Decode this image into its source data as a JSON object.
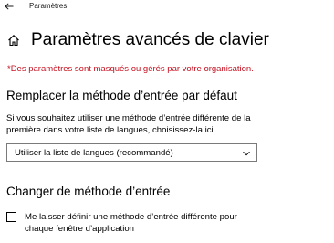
{
  "window": {
    "app_title": "Paramètres"
  },
  "header": {
    "title": "Paramètres avancés de clavier"
  },
  "org_warning": "*Des paramètres sont masqués ou gérés par votre organisation.",
  "input_method_section": {
    "title": "Remplacer la méthode d’entrée par défaut",
    "description_lines": [
      "Si vous souhaitez utiliser une méthode d’entrée différente de la",
      "première dans votre liste de langues, choisissez-la ici"
    ],
    "dropdown_value": "Utiliser la liste de langues (recommandé)"
  },
  "switch_section": {
    "title": "Changer de méthode d’entrée",
    "checkbox_checked": false,
    "checkbox_label_lines": [
      "Me laisser définir une méthode d’entrée différente pour",
      "chaque fenêtre d’application"
    ]
  },
  "colors": {
    "warning": "#c50f1f",
    "background": "#ffffff",
    "text": "#000000"
  },
  "icons": {
    "back": "arrow-left-icon",
    "home": "home-icon",
    "dropdown": "chevron-down-icon"
  }
}
